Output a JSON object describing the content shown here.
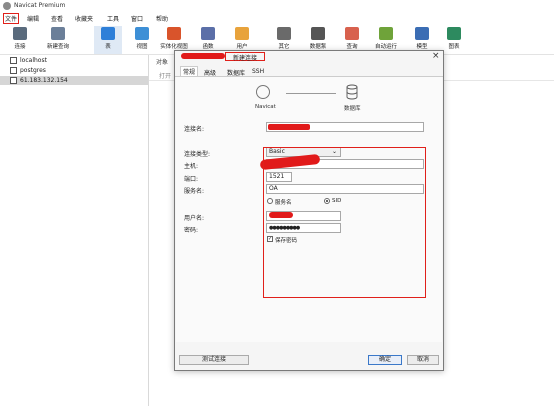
{
  "window": {
    "title": "Navicat Premium"
  },
  "menu": [
    "文件",
    "编辑",
    "查看",
    "收藏夹",
    "工具",
    "窗口",
    "帮助"
  ],
  "toolbar": [
    {
      "label": "连接",
      "icon": "plug-icon",
      "color": "#5a6b7d"
    },
    {
      "label": "新建查询",
      "icon": "query-icon",
      "color": "#6b7f99"
    },
    {
      "label": "表",
      "icon": "table-icon",
      "color": "#2e7fd8"
    },
    {
      "label": "视图",
      "icon": "view-icon",
      "color": "#3d8fd6"
    },
    {
      "label": "实体化视图",
      "icon": "materialized-view-icon",
      "color": "#d9542b"
    },
    {
      "label": "函数",
      "icon": "function-icon",
      "color": "#5b6fa8"
    },
    {
      "label": "用户",
      "icon": "user-icon",
      "color": "#e8a33c"
    },
    {
      "label": "其它",
      "icon": "other-icon",
      "color": "#6a6a6a"
    },
    {
      "label": "数据泵",
      "icon": "data-pump-icon",
      "color": "#555555"
    },
    {
      "label": "查询",
      "icon": "query-grid-icon",
      "color": "#d8614e"
    },
    {
      "label": "自动运行",
      "icon": "automation-icon",
      "color": "#6fa33a"
    },
    {
      "label": "模型",
      "icon": "model-icon",
      "color": "#3b6db4"
    },
    {
      "label": "图表",
      "icon": "chart-icon",
      "color": "#2d8a5f"
    }
  ],
  "tree": [
    {
      "label": "localhost"
    },
    {
      "label": "postgres"
    },
    {
      "label": "61.183.132.154"
    }
  ],
  "main": {
    "object_tab": "对象",
    "open_label": "打开"
  },
  "dialog": {
    "title": "新建连接",
    "tabs": [
      "常规",
      "高级",
      "数据库",
      "SSH"
    ],
    "navicat_label": "Navicat",
    "db_label": "数据库",
    "form": {
      "conn_name_label": "连接名:",
      "conn_type_label": "连接类型:",
      "conn_type_value": "Basic",
      "host_label": "主机:",
      "port_label": "端口:",
      "port_value": "1521",
      "service_label": "服务名:",
      "service_value": "OA",
      "service_name_option": "服务名",
      "sid_option": "SID",
      "user_label": "用户名:",
      "password_label": "密码:",
      "password_value": "●●●●●●●●●",
      "save_password_label": "保存密码"
    },
    "buttons": {
      "test": "测试连接",
      "ok": "确定",
      "cancel": "取消"
    }
  },
  "colors": {
    "highlight": "#e0201a",
    "redaction": "#e11a1a",
    "accent": "#3a78c9"
  }
}
